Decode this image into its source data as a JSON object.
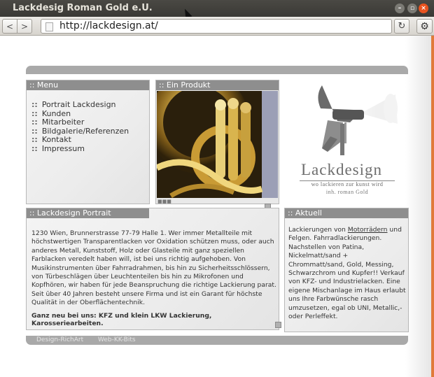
{
  "window": {
    "title": "Lackdesig Roman Gold e.U."
  },
  "toolbar": {
    "back_label": "<",
    "forward_label": ">",
    "url": "http://lackdesign.at/",
    "reload_label": "↻",
    "settings_label": "⚙"
  },
  "menu": {
    "title": ":: Menu",
    "items": [
      {
        "label": "Portrait Lackdesign"
      },
      {
        "label": "Kunden"
      },
      {
        "label": "Mitarbeiter"
      },
      {
        "label": "Bildgalerie/Referenzen"
      },
      {
        "label": "Kontakt"
      },
      {
        "label": "Impressum"
      }
    ],
    "bullet": "::"
  },
  "product": {
    "title": ":: Ein Produkt"
  },
  "logo": {
    "name": "Lackdesign",
    "tagline": "wo lackieren zur kunst wird",
    "owner": "inh. roman Gold"
  },
  "portrait": {
    "title": ":: Lackdesign Portrait",
    "text": "1230 Wien, Brunnerstrasse 77-79 Halle 1. Wer immer Metallteile mit höchstwertigen Transparentlacken vor Oxidation schützen muss, oder auch anderes Metall, Kunststoff, Holz oder Glasteile mit ganz speziellen Farblacken veredelt haben will, ist bei uns richtig aufgehoben. Von Musikinstrumenten über Fahrradrahmen, bis hin zu Sicherheitsschlössern, von Türbeschlägen über Leuchtenteilen bis hin zu Mikrofonen und Kopfhören, wir haben für jede Beanspruchung die richtige Lackierung parat. Seit über 40 Jahren besteht unsere Firma und ist ein Garant für höchste Qualität in der Oberflächentechnik.",
    "highlight": "Ganz neu bei uns: KFZ und klein LKW Lackierung, Karosseriearbeiten."
  },
  "aktuell": {
    "title": ":: Aktuell",
    "text_before": "Lackierungen von ",
    "link": "Motorrädern",
    "text_after": " und Felgen. Fahrradlackierungen. Nachstellen von Patina, Nickelmatt/sand + Chrommatt/sand, Gold, Messing, Schwarzchrom und Kupfer!! Verkauf von KFZ- und Industrielacken. Eine eigene Mischanlage im Haus erlaubt uns Ihre Farbwünsche rasch umzusetzen, egal ob UNI, Metallic,-oder Perleffekt."
  },
  "footer": {
    "left": "Design-RichArt",
    "right": "Web-KK-Bits"
  },
  "colors": {
    "panel_header": "#8e8e8e",
    "band": "#a9a9a9",
    "close_button": "#e9531f"
  }
}
